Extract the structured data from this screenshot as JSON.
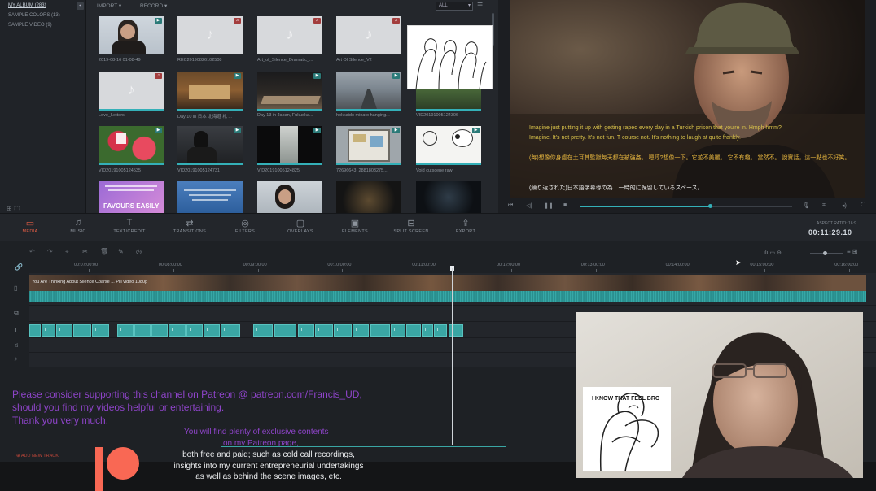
{
  "library": {
    "items": [
      "MY ALBUM (283)",
      "SAMPLE COLORS (13)",
      "SAMPLE VIDEO (9)"
    ]
  },
  "media_toolbar": {
    "import_label": "IMPORT",
    "record_label": "RECORD",
    "filter_value": "ALL"
  },
  "media_items": [
    {
      "label": "2019-08-16 01-08-49",
      "kind": "video"
    },
    {
      "label": "REC20190826102508",
      "kind": "audio"
    },
    {
      "label": "Art_of_Silence_Dramatic_...",
      "kind": "audio"
    },
    {
      "label": "Art Of Silence_V2",
      "kind": "audio"
    },
    {
      "label": "Love_Letters",
      "kind": "audio"
    },
    {
      "label": "Day 10 in 日本 北海道 札 ...",
      "kind": "video"
    },
    {
      "label": "Day 13 in Japan, Fukuoka...",
      "kind": "video"
    },
    {
      "label": "hokkaido minato hanging...",
      "kind": "video"
    },
    {
      "label": "VID20191005124306",
      "kind": "video"
    },
    {
      "label": "VID20191005124535",
      "kind": "video"
    },
    {
      "label": "VID20191005124731",
      "kind": "video"
    },
    {
      "label": "VID20191005124825",
      "kind": "video"
    },
    {
      "label": "72696643_2881803275...",
      "kind": "video"
    },
    {
      "label": "Void cutscene raw",
      "kind": "video"
    },
    {
      "label": "",
      "kind": "video"
    },
    {
      "label": "",
      "kind": "video"
    },
    {
      "label": "",
      "kind": "video"
    },
    {
      "label": "",
      "kind": "video"
    },
    {
      "label": "",
      "kind": "video"
    }
  ],
  "thumb_text": {
    "favours": "FAVOURS EASILY"
  },
  "preview": {
    "subtitle_en_1": "Imagine just putting it up with getting raped every day in a Turkish prison that you're in. Hmph hmm?",
    "subtitle_en_2": "Imagine. It's not pretty. It's not fun. T course not. It's nothing to laugh at quite frankly.",
    "subtitle_zh": "(每)想像你身處在土耳其監獄每天都在被強姦。 嗯哼?想像一下。它並不美麗。 它不有趣。 當然不。 說實話，這一點也不好笑。",
    "subtitle_ja": "(繰り返された)日本語字幕導の為　一時的に保留しているスペース。",
    "progress": 0.61
  },
  "main_tabs": [
    {
      "label": "MEDIA",
      "icon": "folder-icon",
      "active": true
    },
    {
      "label": "MUSIC",
      "icon": "music-note-icon",
      "active": false
    },
    {
      "label": "TEXT/CREDIT",
      "icon": "text-icon",
      "active": false
    },
    {
      "label": "TRANSITIONS",
      "icon": "transition-icon",
      "active": false
    },
    {
      "label": "FILTERS",
      "icon": "filter-icon",
      "active": false
    },
    {
      "label": "OVERLAYS",
      "icon": "overlay-icon",
      "active": false
    },
    {
      "label": "ELEMENTS",
      "icon": "elements-icon",
      "active": false
    },
    {
      "label": "SPLIT SCREEN",
      "icon": "split-screen-icon",
      "active": false
    },
    {
      "label": "EXPORT",
      "icon": "export-icon",
      "active": false
    }
  ],
  "aspect_ratio_label": "ASPECT RATIO: 16:9",
  "timecode": "00:11:29.10",
  "ruler_ticks": [
    "00:07:00:00",
    "00:08:00:00",
    "00:09:00:00",
    "00:10:00:00",
    "00:11:00:00",
    "00:12:00:00",
    "00:13:00:00",
    "00:14:00:00",
    "00:15:00:00",
    "00:16:00:00"
  ],
  "video_clip_label": "You Are Thinking About Silence Coarse ... Pill video 1080p",
  "title_clip_text": "T",
  "title_clip_long": "T Title",
  "add_track_label": "ADD NEW TRACK",
  "overlay": {
    "patreon_lines": [
      "Please consider supporting this channel on Patreon @ patreon.com/Francis_UD,",
      "should you find my videos helpful or entertaining.",
      "Thank you very much."
    ],
    "exclusive_lines": [
      "You will find plenty of exclusive contents",
      "on my Patreon page,"
    ],
    "body_lines": [
      "both free and paid; such as cold call recordings,",
      "insights into my current entrepreneurial undertakings",
      "as well as behind the scene images, etc."
    ]
  },
  "webcam": {
    "meme_caption": "I KNOW THAT FEEL BRO"
  },
  "colors": {
    "accent_teal": "#34b0b8",
    "active_tab": "#e65e45",
    "patreon_purple": "#8e44c9",
    "patreon_red": "#f96854"
  }
}
